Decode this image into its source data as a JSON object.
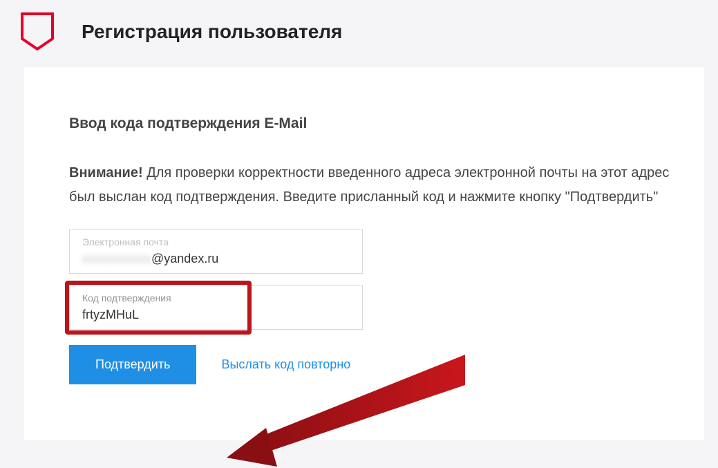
{
  "header": {
    "title": "Регистрация пользователя"
  },
  "main": {
    "section_title": "Ввод кода подтверждения E-Mail",
    "attention_label": "Внимание!",
    "attention_text": " Для проверки корректности введенного адреса электронной почты на этот адрес был выслан код подтверждения. Введите присланный код и нажмите кнопку \"Подтвердить\"",
    "email": {
      "label": "Электронная почта",
      "value_hidden": "xxxxxxxxxx",
      "value_visible": "@yandex.ru"
    },
    "code": {
      "label": "Код подтверждения",
      "value": "frtyzMHuL"
    },
    "confirm_label": "Подтвердить",
    "resend_label": "Выслать код повторно"
  },
  "colors": {
    "accent": "#1f8fe6",
    "highlight": "#b9151b"
  }
}
